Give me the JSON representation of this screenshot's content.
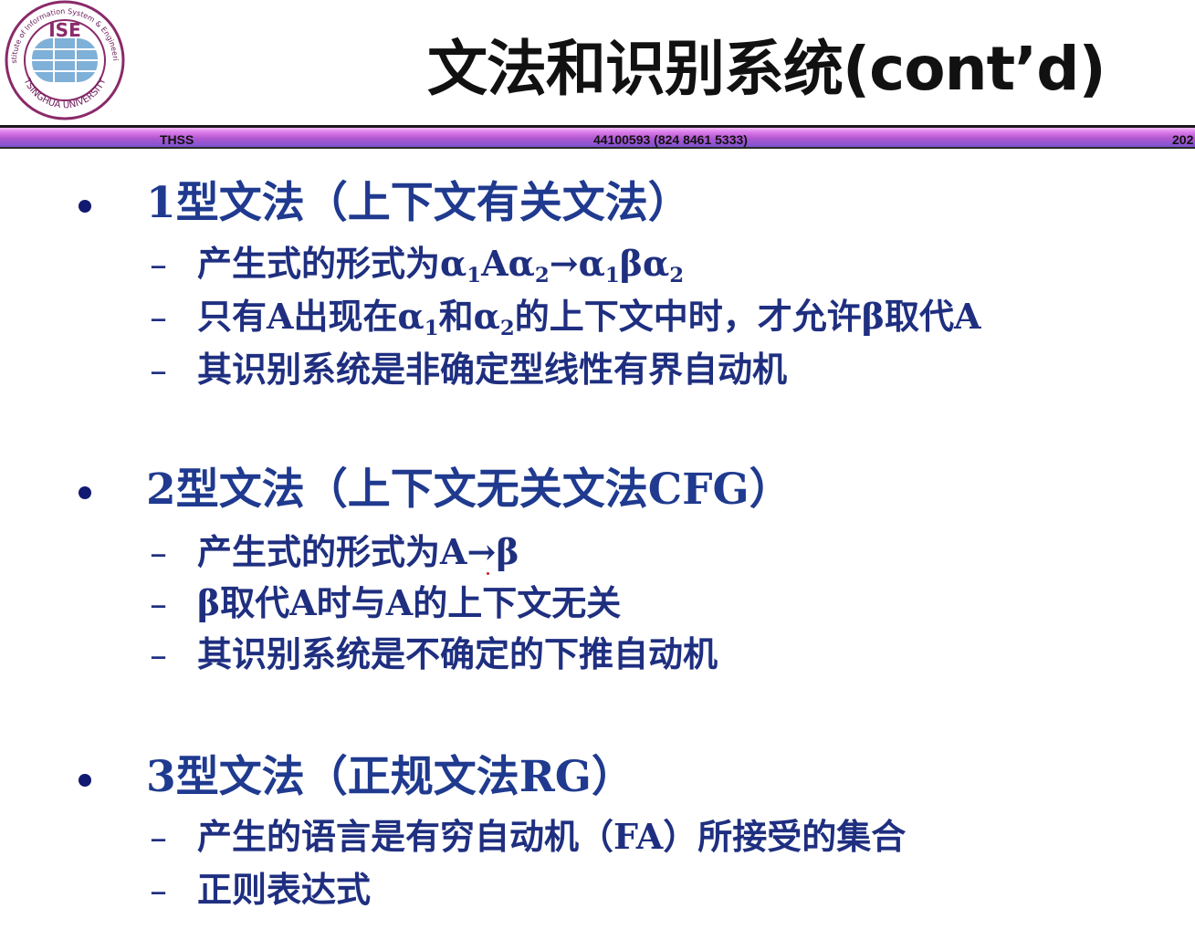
{
  "header": {
    "title": "文法和识别系统(cont’d)",
    "logo": {
      "top_arc_text": "Institute of Information System & Engineering",
      "bottom_arc_text": "TSINGHUA UNIVERSITY",
      "emblem_text": "ISE"
    }
  },
  "bar": {
    "left": "THSS",
    "center": "44100593 (824 8461 5333)",
    "right": "202"
  },
  "sections": [
    {
      "heading": "1型文法（上下文有关文法）",
      "items": [
        {
          "dash": "–",
          "parts": [
            {
              "t": "产生式的形式为α"
            },
            {
              "sub": "1"
            },
            {
              "t": "Aα"
            },
            {
              "sub": "2"
            },
            {
              "t": "→α"
            },
            {
              "sub": "1"
            },
            {
              "t": "βα"
            },
            {
              "sub": "2"
            }
          ]
        },
        {
          "dash": "–",
          "parts": [
            {
              "t": "只有A出现在α"
            },
            {
              "sub": "1"
            },
            {
              "t": "和α"
            },
            {
              "sub": "2"
            },
            {
              "t": "的上下文中时，才允许β取代A"
            }
          ]
        },
        {
          "dash": "–",
          "parts": [
            {
              "t": "其识别系统是非确定型线性有界自动机"
            }
          ]
        }
      ]
    },
    {
      "heading": "2型文法（上下文无关文法CFG）",
      "items": [
        {
          "dash": "–",
          "parts": [
            {
              "t": "产生式的形式为A→β"
            }
          ]
        },
        {
          "dash": "–",
          "parts": [
            {
              "t": "β取代A时与A的上下文无关"
            }
          ]
        },
        {
          "dash": "–",
          "parts": [
            {
              "t": "其识别系统是不确定的下推自动机"
            }
          ]
        }
      ]
    },
    {
      "heading": "3型文法（正规文法RG）",
      "items": [
        {
          "dash": "–",
          "parts": [
            {
              "t": "产生的语言是有穷自动机（FA）所接受的集合"
            }
          ]
        },
        {
          "dash": "–",
          "parts": [
            {
              "t": "正则表达式"
            }
          ]
        }
      ]
    }
  ]
}
